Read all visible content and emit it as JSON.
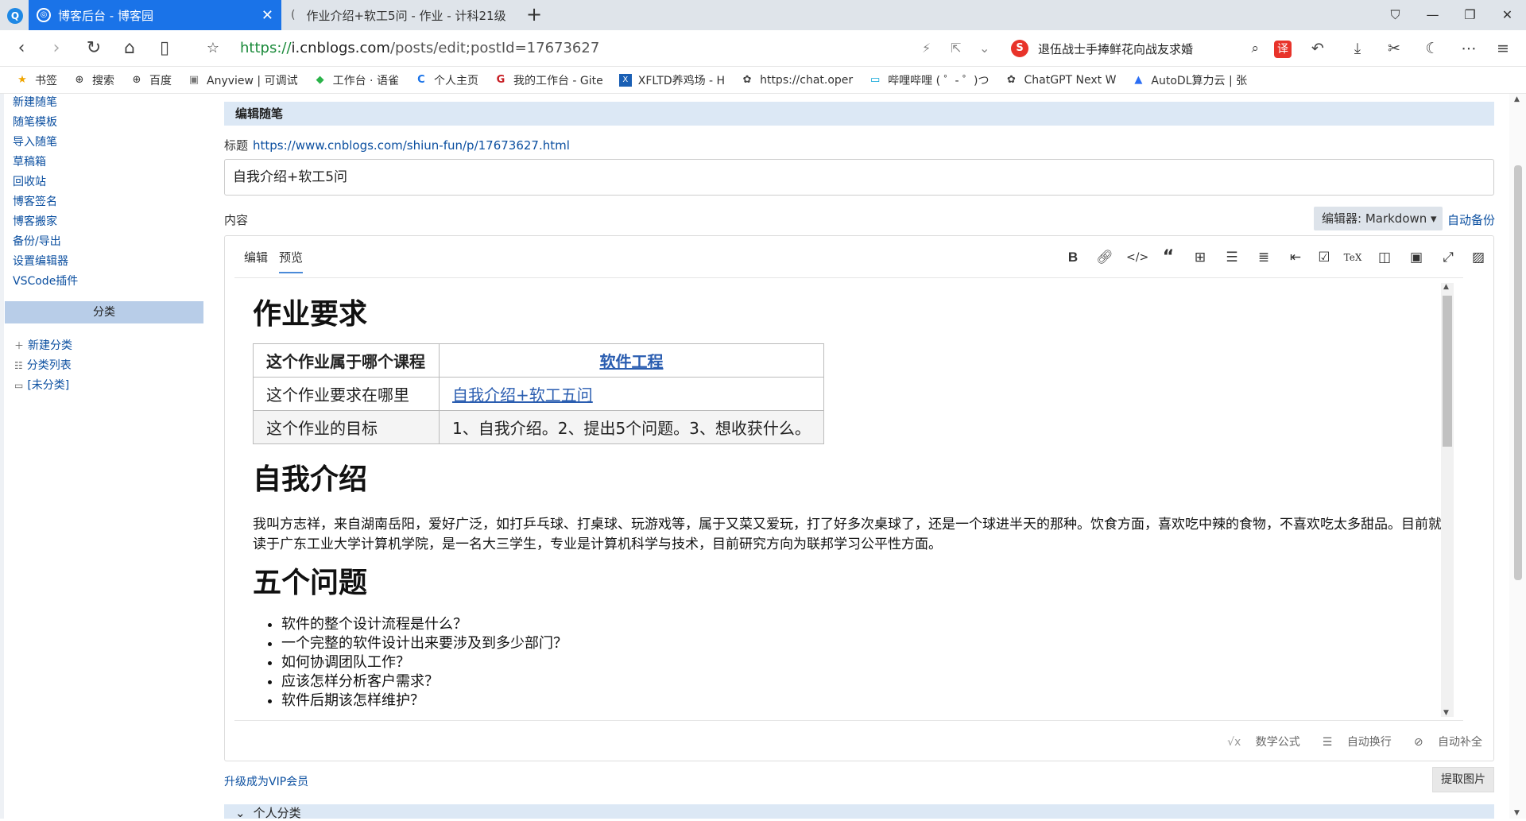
{
  "browser": {
    "active_tab_title": "博客后台 - 博客园",
    "inactive_tab_title": "作业介绍+软工5问 - 作业 - 计科21级",
    "url_scheme": "https://",
    "url_host": "i.cnblogs.com",
    "url_path": "/posts/edit;postId=17673627",
    "search_text": "退伍战士手捧鲜花向战友求婚"
  },
  "bookmarks": [
    {
      "label": "书签",
      "icon": "star-icon"
    },
    {
      "label": "搜索",
      "icon": "globe-icon"
    },
    {
      "label": "百度",
      "icon": "globe-icon"
    },
    {
      "label": "Anyview | 可调试",
      "icon": "anyview-icon"
    },
    {
      "label": "工作台 · 语雀",
      "icon": "yuque-icon"
    },
    {
      "label": "个人主页",
      "icon": "csdn-icon"
    },
    {
      "label": "我的工作台 - Gite",
      "icon": "gitee-icon"
    },
    {
      "label": "XFLTD养鸡场 - H",
      "icon": "xfltd-icon"
    },
    {
      "label": "https://chat.oper",
      "icon": "openai-icon"
    },
    {
      "label": "哔哩哔哩 ( ゜- ゜)つ",
      "icon": "bilibili-icon"
    },
    {
      "label": "ChatGPT Next W",
      "icon": "chatgpt-icon"
    },
    {
      "label": "AutoDL算力云 | 张",
      "icon": "autodl-icon"
    }
  ],
  "sidebar": {
    "links": [
      "新建随笔",
      "随笔模板",
      "导入随笔",
      "草稿箱",
      "回收站",
      "博客签名",
      "博客搬家",
      "备份/导出",
      "设置编辑器",
      "VSCode插件"
    ],
    "category_header": "分类",
    "category_items": [
      {
        "label": "新建分类",
        "icon": "plus-icon"
      },
      {
        "label": "分类列表",
        "icon": "list-icon"
      },
      {
        "label": "[未分类]",
        "icon": "folder-icon"
      }
    ]
  },
  "main": {
    "header": "编辑随笔",
    "title_label": "标题",
    "title_link": "https://www.cnblogs.com/shiun-fun/p/17673627.html",
    "title_value": "自我介绍+软工5问",
    "content_label": "内容",
    "editor_select": "编辑器: Markdown ▾",
    "auto_backup": "自动备份",
    "tabs": [
      "编辑",
      "预览"
    ],
    "toolbar": [
      "bold-icon",
      "link-icon",
      "code-icon",
      "quote-icon",
      "table-icon",
      "bullet-list-icon",
      "ordered-list-icon",
      "outdent-icon",
      "checkbox-icon",
      "tex-icon",
      "split-view-icon",
      "save-icon",
      "fullscreen-icon",
      "image-icon"
    ],
    "footer_tools": [
      "数学公式",
      "自动换行",
      "自动补全"
    ],
    "vip_link": "升级成为VIP会员",
    "extract_button": "提取图片",
    "bottom_section": "个人分类"
  },
  "preview": {
    "h1_req": "作业要求",
    "table": [
      [
        "这个作业属于哪个课程",
        "软件工程"
      ],
      [
        "这个作业要求在哪里",
        "自我介绍+软工五问"
      ],
      [
        "这个作业的目标",
        "1、自我介绍。2、提出5个问题。3、想收获什么。"
      ]
    ],
    "h1_intro": "自我介绍",
    "intro_text": "我叫方志祥，来自湖南岳阳，爱好广泛，如打乒乓球、打桌球、玩游戏等，属于又菜又爱玩，打了好多次桌球了，还是一个球进半天的那种。饮食方面，喜欢吃中辣的食物，不喜欢吃太多甜品。目前就读于广东工业大学计算机学院，是一名大三学生，专业是计算机科学与技术，目前研究方向为联邦学习公平性方面。",
    "h1_questions": "五个问题",
    "questions": [
      "软件的整个设计流程是什么？",
      "一个完整的软件设计出来要涉及到多少部门？",
      "如何协调团队工作？",
      "应该怎样分析客户需求？",
      "软件后期该怎样维护？"
    ]
  }
}
